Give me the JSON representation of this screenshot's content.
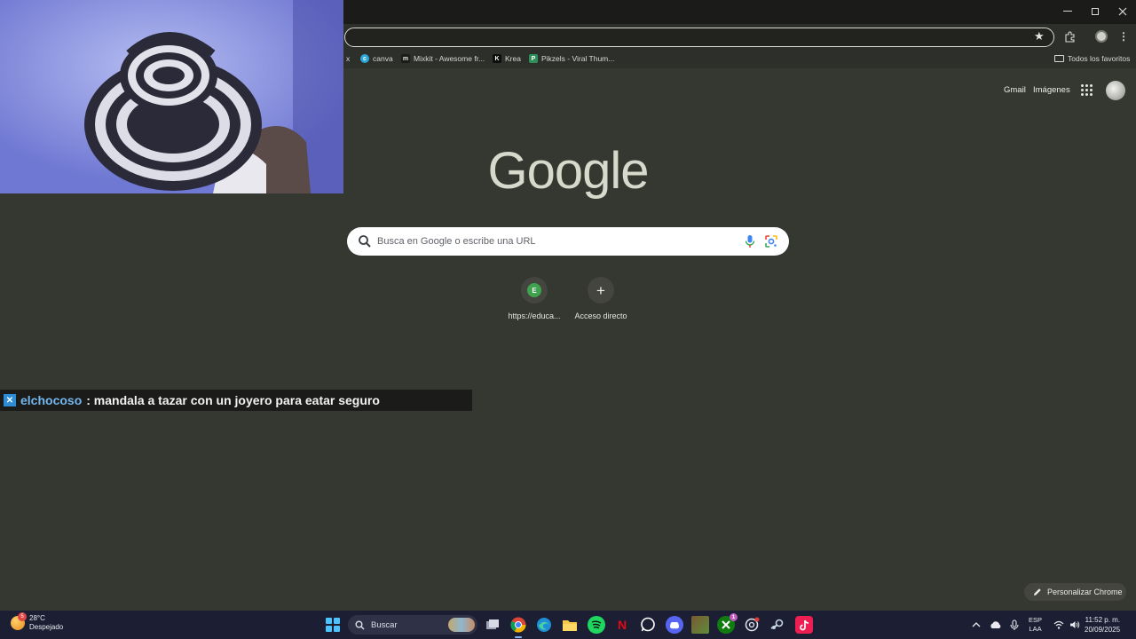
{
  "window": {
    "minimize_icon": "minimize-icon",
    "maximize_icon": "maximize-icon",
    "close_icon": "close-icon"
  },
  "bookmarks_bar": {
    "items": [
      {
        "label": "x",
        "icon": "x-icon"
      },
      {
        "label": "canva",
        "icon": "canva-icon"
      },
      {
        "label": "Mixkit - Awesome fr...",
        "icon": "mixkit-icon"
      },
      {
        "label": "Krea",
        "icon": "krea-icon"
      },
      {
        "label": "Pikzels - Viral Thum...",
        "icon": "pikzels-icon"
      }
    ],
    "all_bookmarks": "Todos los favoritos"
  },
  "ntp": {
    "gmail": "Gmail",
    "images": "Imágenes",
    "logo": "Google",
    "search_placeholder": "Busca en Google o escribe una URL",
    "shortcuts": [
      {
        "label": "https://educa...",
        "favicon_letter": "E"
      },
      {
        "label": "Acceso directo",
        "icon": "plus-icon"
      }
    ],
    "customize": "Personalizar Chrome"
  },
  "chat": {
    "username": "elchocoso",
    "message": ": mandala a tazar con un joyero para eatar seguro"
  },
  "taskbar": {
    "weather_temp": "28°C",
    "weather_desc": "Despejado",
    "weather_alert": "5",
    "search_label": "Buscar",
    "xbox_badge": "1",
    "lang_top": "ESP",
    "lang_bottom": "LAA",
    "time": "11:52 p. m.",
    "date": "20/09/2025"
  },
  "colors": {
    "page_bg": "#353731",
    "taskbar_bg": "#1c1f34",
    "chat_user": "#74b6f0",
    "windows_accent": "#4cc2ff"
  }
}
